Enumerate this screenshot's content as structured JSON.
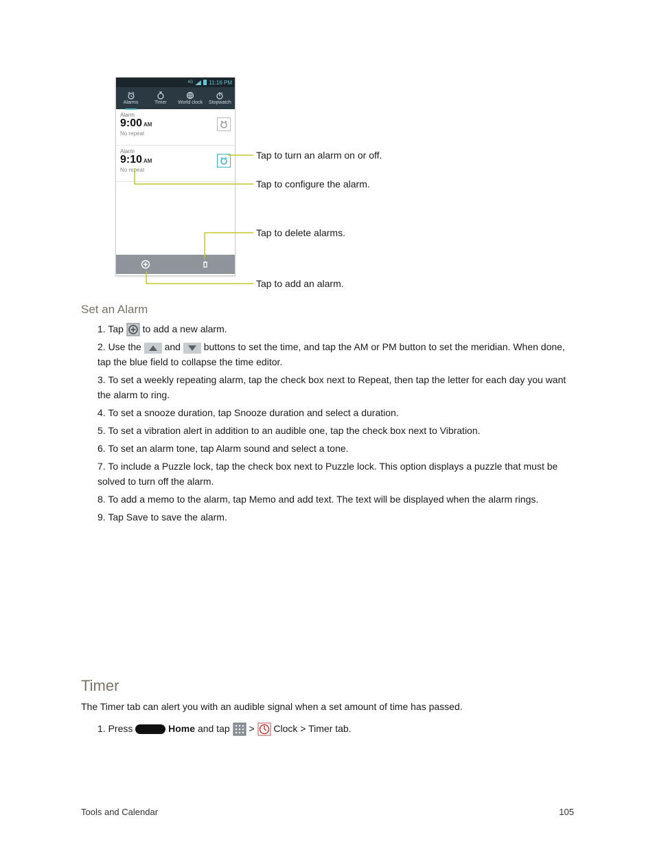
{
  "statusbar": {
    "time": "11:16 PM"
  },
  "tabs": {
    "alarms": "Alarms",
    "timer": "Timer",
    "worldclock": "World clock",
    "stopwatch": "Stopwatch"
  },
  "alarms": [
    {
      "label": "Alarm",
      "time": "9:00",
      "ampm": "AM",
      "repeat": "No repeat",
      "on": false
    },
    {
      "label": "Alarm",
      "time": "9:10",
      "ampm": "AM",
      "repeat": "No repeat",
      "on": true
    }
  ],
  "callouts": {
    "toggle": "Tap to turn an alarm on or off.",
    "configure": "Tap to configure the alarm.",
    "delete": "Tap to delete alarms.",
    "add": "Tap to add an alarm."
  },
  "section1": {
    "heading": "Set an Alarm",
    "p1a": "1. Tap ",
    "p1b": " to add a new alarm.",
    "p2a": "2. Use the ",
    "p2b": " and ",
    "p2c": " buttons to set the time, and tap the AM or PM button to set the meridian. When done, tap the blue field to collapse the time editor.",
    "p3": "3. To set a weekly repeating alarm, tap the check box next to Repeat, then tap the letter for each day you want the alarm to ring.",
    "p4": "4. To set a snooze duration, tap Snooze duration and select a duration.",
    "p5": "5. To set a vibration alert in addition to an audible one, tap the check box next to Vibration.",
    "p6": "6. To set an alarm tone, tap Alarm sound and select a tone.",
    "p7": "7. To include a Puzzle lock, tap the check box next to Puzzle lock. This option displays a puzzle that must be solved to turn off the alarm.",
    "p8": "8. To add a memo to the alarm, tap Memo and add text. The text will be displayed when the alarm rings.",
    "p9": "9. Tap Save to save the alarm."
  },
  "section2": {
    "heading": "Timer",
    "p1": "The Timer tab can alert you with an audible signal when a set amount of time has passed.",
    "p2a": "1. Press ",
    "p2b": " and tap ",
    "p2c": " > ",
    "p2d": " Clock > Timer tab.",
    "homekey": "Home"
  },
  "footer": {
    "left": "Tools and Calendar",
    "page": "105"
  }
}
